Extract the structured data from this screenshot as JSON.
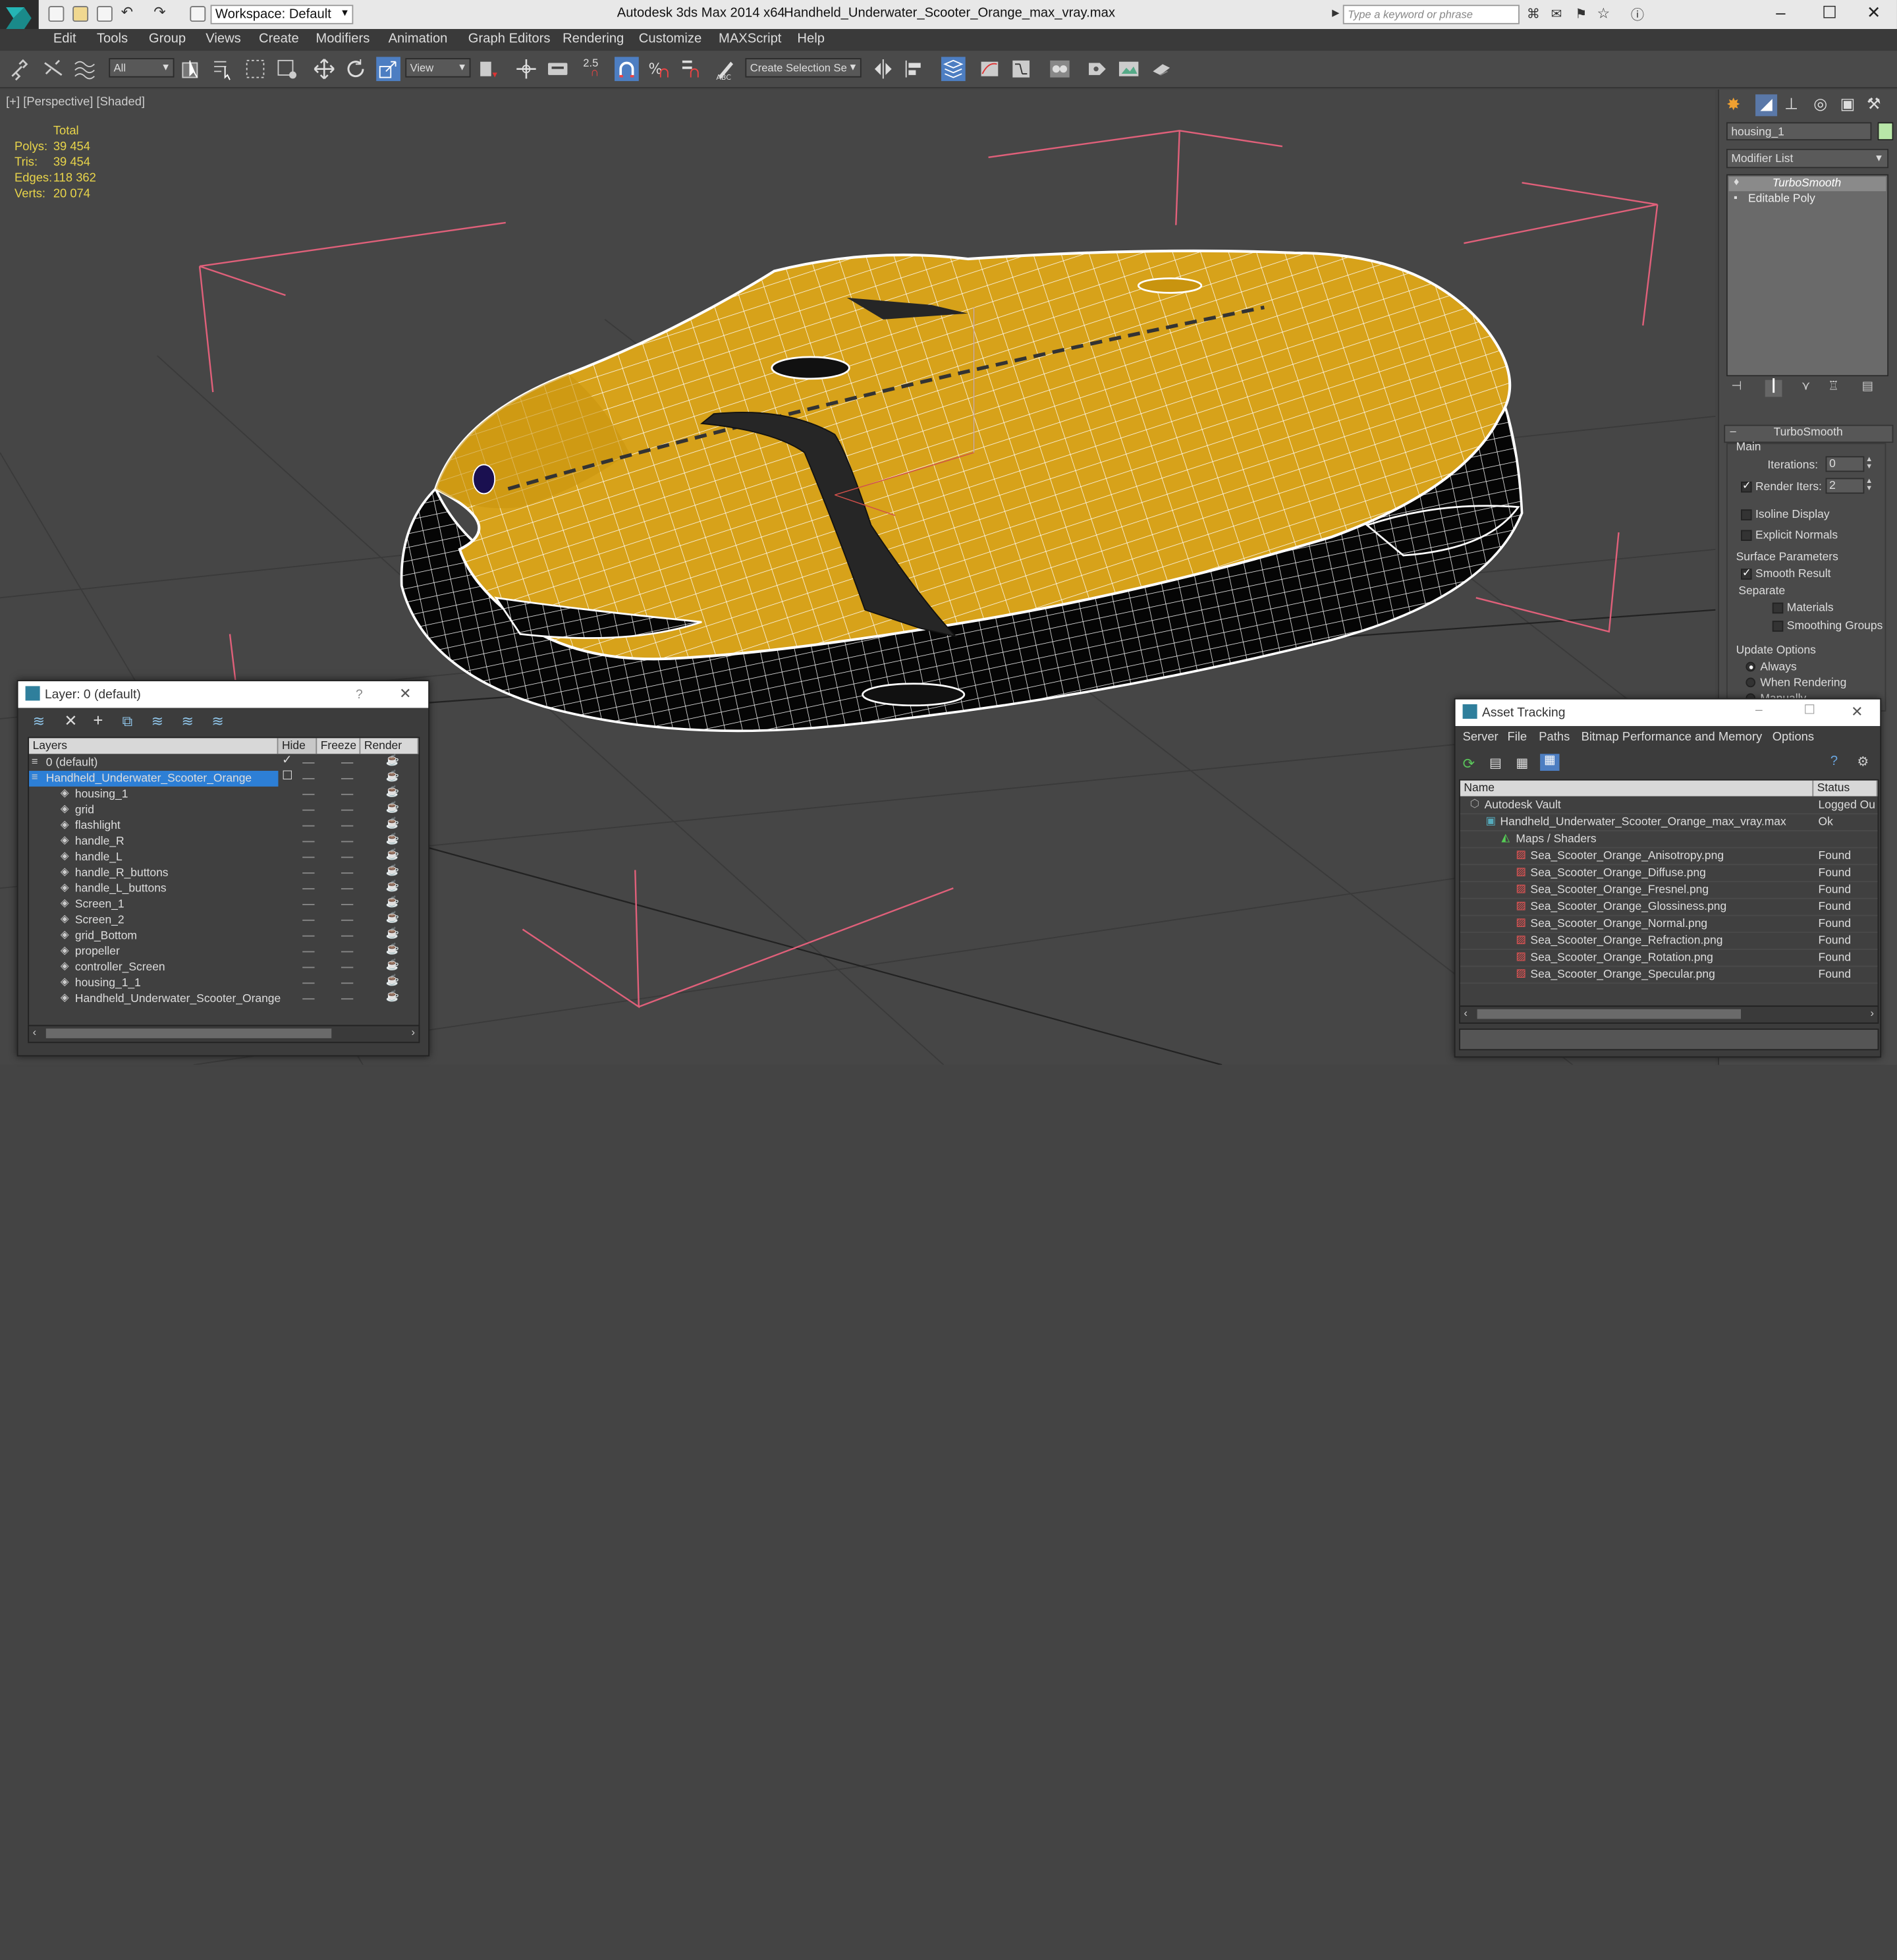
{
  "titlebar": {
    "app": "Autodesk 3ds Max  2014 x64",
    "file": "Handheld_Underwater_Scooter_Orange_max_vray.max",
    "workspace": "Workspace: Default",
    "search_placeholder": "Type a keyword or phrase"
  },
  "menu": [
    "Edit",
    "Tools",
    "Group",
    "Views",
    "Create",
    "Modifiers",
    "Animation",
    "Graph Editors",
    "Rendering",
    "Customize",
    "MAXScript",
    "Help"
  ],
  "toolbar": {
    "filter": "All",
    "refcoord": "View",
    "snap_angle": "2.5",
    "named_sel": "Create Selection Se"
  },
  "viewport": {
    "label": "[+] [Perspective] [Shaded]",
    "stats_header": "Total",
    "stats": [
      {
        "label": "Polys:",
        "value": "39 454"
      },
      {
        "label": "Tris:",
        "value": "39 454"
      },
      {
        "label": "Edges:",
        "value": "118 362"
      },
      {
        "label": "Verts:",
        "value": "20 074"
      }
    ]
  },
  "command_panel": {
    "object_name": "housing_1",
    "modifier_list": "Modifier List",
    "stack": [
      "TurboSmooth",
      "Editable Poly"
    ],
    "rollout_title": "TurboSmooth",
    "main": "Main",
    "iterations_label": "Iterations:",
    "iterations": "0",
    "render_iters_label": "Render Iters:",
    "render_iters": "2",
    "isoline": "Isoline Display",
    "explicit_normals": "Explicit Normals",
    "surface_params": "Surface Parameters",
    "smooth_result": "Smooth Result",
    "separate": "Separate",
    "materials": "Materials",
    "smoothing_groups": "Smoothing Groups",
    "update_options": "Update Options",
    "always": "Always",
    "when_rendering": "When Rendering",
    "manually": "Manually"
  },
  "layer_window": {
    "title": "Layer: 0 (default)",
    "help": "?",
    "columns": [
      "Layers",
      "Hide",
      "Freeze",
      "Render"
    ],
    "layers": [
      "0 (default)",
      "Handheld_Underwater_Scooter_Orange"
    ],
    "objects": [
      "housing_1",
      "grid",
      "flashlight",
      "handle_R",
      "handle_L",
      "handle_R_buttons",
      "handle_L_buttons",
      "Screen_1",
      "Screen_2",
      "grid_Bottom",
      "propeller",
      "controller_Screen",
      "housing_1_1",
      "Handheld_Underwater_Scooter_Orange"
    ]
  },
  "asset_window": {
    "title": "Asset Tracking",
    "menu": [
      "Server",
      "File",
      "Paths",
      "Bitmap Performance and Memory",
      "Options"
    ],
    "columns": [
      "Name",
      "Status"
    ],
    "rows": [
      {
        "name": "Autodesk Vault",
        "status": "Logged Ou"
      },
      {
        "name": "Handheld_Underwater_Scooter_Orange_max_vray.max",
        "status": "Ok"
      },
      {
        "name": "Maps / Shaders",
        "status": ""
      },
      {
        "name": "Sea_Scooter_Orange_Anisotropy.png",
        "status": "Found"
      },
      {
        "name": "Sea_Scooter_Orange_Diffuse.png",
        "status": "Found"
      },
      {
        "name": "Sea_Scooter_Orange_Fresnel.png",
        "status": "Found"
      },
      {
        "name": "Sea_Scooter_Orange_Glossiness.png",
        "status": "Found"
      },
      {
        "name": "Sea_Scooter_Orange_Normal.png",
        "status": "Found"
      },
      {
        "name": "Sea_Scooter_Orange_Refraction.png",
        "status": "Found"
      },
      {
        "name": "Sea_Scooter_Orange_Rotation.png",
        "status": "Found"
      },
      {
        "name": "Sea_Scooter_Orange_Specular.png",
        "status": "Found"
      }
    ]
  },
  "colors": {
    "accent": "#2d7fd6",
    "model": "#d7a21a",
    "wire": "#ffffff",
    "stats": "#e8d44a"
  }
}
